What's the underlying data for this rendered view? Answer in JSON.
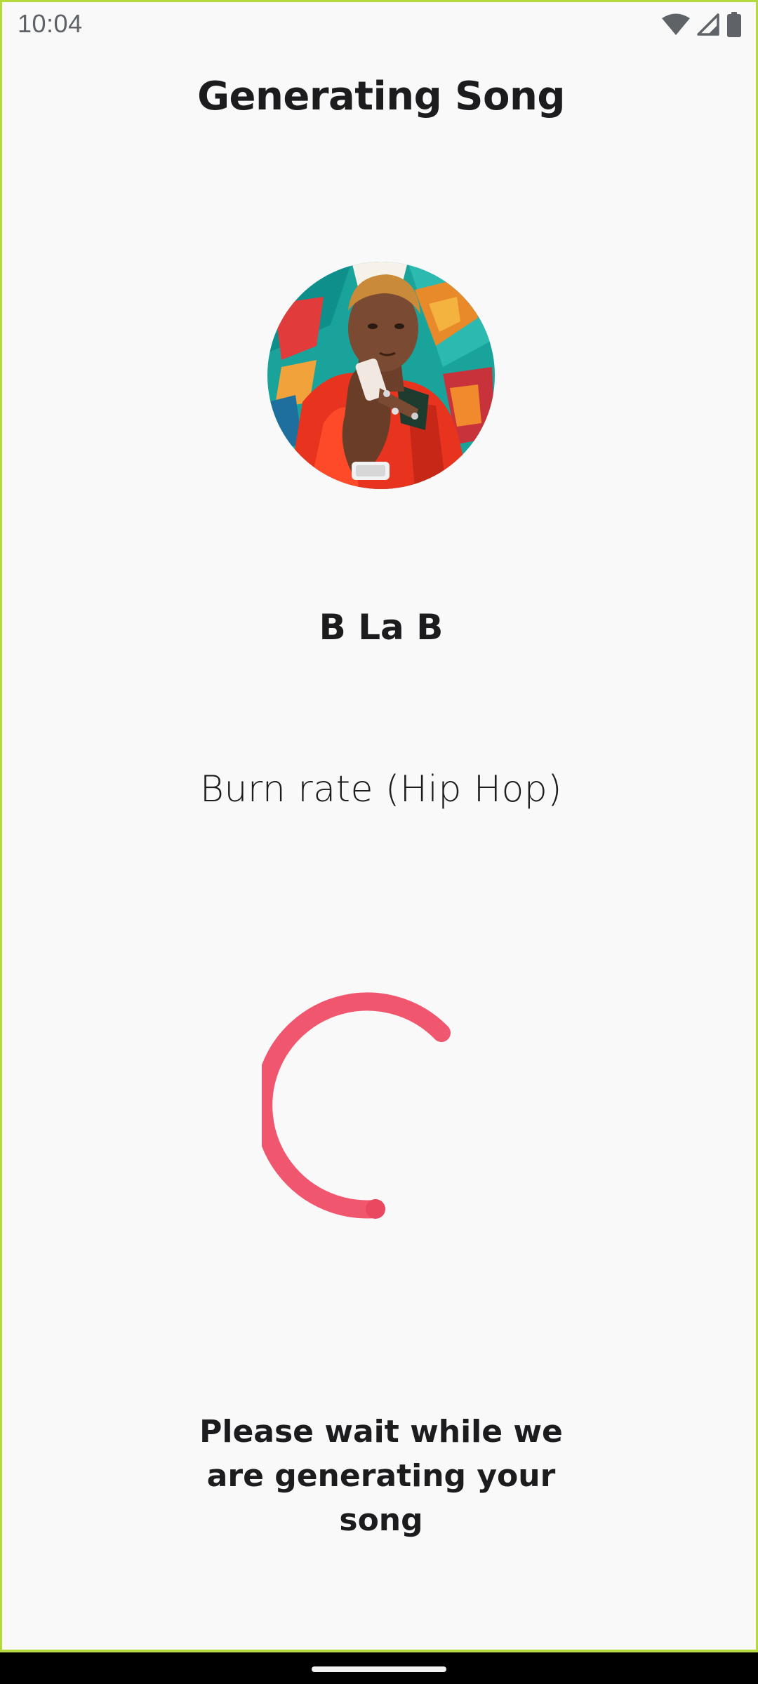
{
  "status_bar": {
    "time": "10:04",
    "icons": [
      "wifi-icon",
      "cellular-signal-icon",
      "battery-icon"
    ]
  },
  "header": {
    "title": "Generating Song"
  },
  "artist": {
    "name": "B La B",
    "avatar_icon": "artist-avatar"
  },
  "song": {
    "title": "Burn rate (Hip Hop)"
  },
  "progress": {
    "indicator": "circular-progress-spinner",
    "color": "#f0566d"
  },
  "message": {
    "text": "Please wait while we are generating your song"
  },
  "colors": {
    "background": "#f9f9fa",
    "accent": "#f0566d",
    "frame_border": "#b5d83a"
  }
}
